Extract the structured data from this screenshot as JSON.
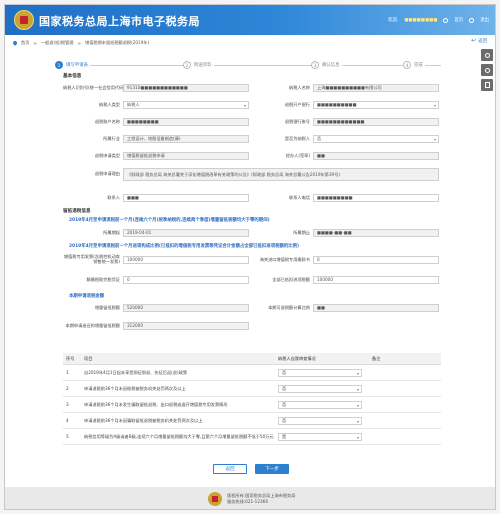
{
  "header": {
    "title": "国家税务总局上海市电子税务局",
    "welcome": "欢迎,",
    "user": "■■■■■■■■",
    "links": [
      "首页",
      "退出"
    ]
  },
  "breadcrumb": [
    "首页",
    "一般退(抵)税管理",
    "增值税期末留抵税额退税(2019年)"
  ],
  "back_label": "返回",
  "steps": [
    {
      "num": "1",
      "label": "填写申请表",
      "active": true
    },
    {
      "num": "2",
      "label": "附送资料",
      "active": false
    },
    {
      "num": "3",
      "label": "确认信息",
      "active": false
    },
    {
      "num": "4",
      "label": "完成",
      "active": false
    }
  ],
  "basic_section": "基本信息",
  "fields": {
    "taxpayer_id": {
      "label": "纳税人识别号(统一社会信用代码)",
      "value": "91310■■■■■■■■■■■■"
    },
    "taxpayer_name": {
      "label": "纳税人名称",
      "value": "上海■■■■■■■■■■有限公司"
    },
    "taxpayer_type": {
      "label": "纳税人类型",
      "value": "纳税人"
    },
    "bank_name": {
      "label": "退税开户银行",
      "value": "■■■■■■■■■■"
    },
    "account_name": {
      "label": "退税账户名称",
      "value": "■■■■■■■■"
    },
    "account_no": {
      "label": "退税银行账号",
      "value": "■■■■■■■■■■■■"
    },
    "industry": {
      "label": "所属行业",
      "value": "工程设计、地图设备制造(康)"
    },
    "credit_level": {
      "label": "是否为纳税人",
      "value": "否"
    },
    "biz_type": {
      "label": "退税申请类型",
      "value": "增值税留抵退税申请"
    },
    "approver": {
      "label": "经办人(签章)",
      "value": "■■"
    },
    "reason": {
      "label": "退税申请理由",
      "value": "《财政部 税务总局 海关总署关于深化增值税改革有关政策的公告》(财政部 税务总局 海关总署公告2019年第39号)"
    },
    "contact": {
      "label": "联系人",
      "value": "■■■"
    },
    "phone": {
      "label": "联系人电话",
      "value": "■■■■■■■■■"
    }
  },
  "retention_section": "留抵退税信息",
  "note1": "2019年4月至申请退税前一个月(连续六个月(按季纳税的,连续两个季度)增量留抵税额均大于零的期间)",
  "period": {
    "from_label": "所属期起",
    "from_value": "2019-04-01",
    "to_label": "所属期止",
    "to_value": "■■■■-■■-■■"
  },
  "note2": "2019年4月至申请退税前一个月进项构成比例(已抵扣的增值税专用发票等凭证合计金额占全部已抵扣进项税额的比例)",
  "ratio": {
    "a_label": "增值税专用发票(含税控机动车销售统一发票)",
    "a_value": "100000",
    "b_label": "海关进口增值税专用缴款书",
    "b_value": "0",
    "c_label": "解缴税款完税凭证",
    "c_value": "0",
    "d_label": "全部已抵扣进项税额",
    "d_value": "100000"
  },
  "calc_section": "本期申请退税金额",
  "calc": {
    "increase_label": "增量留抵税额",
    "increase_value": "520000",
    "ratio_label": "本期可退税额计算比例",
    "ratio_value": "■■",
    "refund_label": "本期申请退还的增量留抵税额",
    "refund_value": "312000"
  },
  "table": {
    "headers": [
      "序号",
      "项目",
      "纳税人自我审查情况",
      "备注"
    ],
    "rows": [
      {
        "no": "1",
        "item": "自2019年4月1日起未享受即征即退、先征后返(退)政策",
        "answer": "否"
      },
      {
        "no": "2",
        "item": "申请退税前36个月未因偷税被税务机关处罚两次及以上",
        "answer": "否"
      },
      {
        "no": "3",
        "item": "申请退税前36个月未发生骗取留抵退税、出口退税或虚开增值税专用发票情形",
        "answer": "否"
      },
      {
        "no": "4",
        "item": "申请退税前36个月未因骗取留抵退税被税务机关处罚两次及以上",
        "answer": "否"
      },
      {
        "no": "5",
        "item": "纳税信用等级为A级或者B级,连续六个月增量留抵税额均大于零,且第六个月增量留抵税额不低于50万元",
        "answer": "是"
      }
    ]
  },
  "buttons": {
    "prev": "返回",
    "next": "下一步"
  },
  "footer": {
    "line1": "版权所有:国家税务总局上海市税务局",
    "line2": "服务热线:021-12366"
  }
}
